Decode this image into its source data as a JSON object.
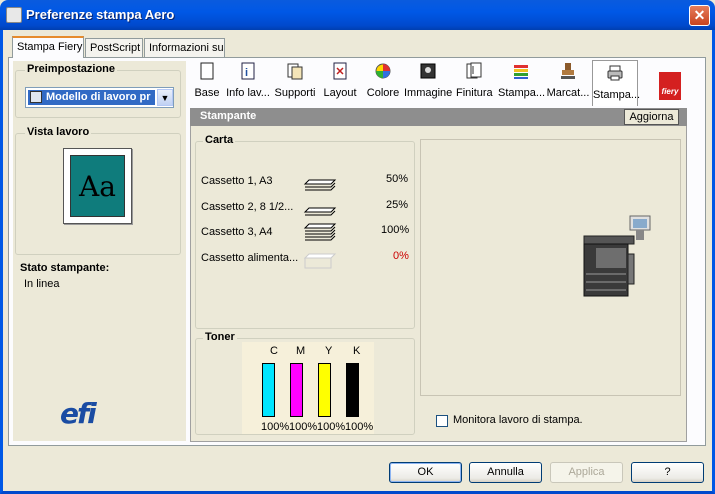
{
  "window": {
    "title": "Preferenze stampa Aero",
    "close_symbol": "✕"
  },
  "tabs": [
    {
      "label": "Stampa Fiery",
      "active": true
    },
    {
      "label": "PostScript",
      "active": false
    },
    {
      "label": "Informazioni su",
      "active": false
    }
  ],
  "left": {
    "preset_label": "Preimpostazione",
    "preset_value": "Modello di lavoro pr",
    "view_label": "Vista lavoro",
    "preview_text": "Aa",
    "printer_status_label": "Stato stampante:",
    "printer_status_value": "In linea",
    "brand_logo": "efi"
  },
  "toolbar": [
    {
      "label": "Base",
      "icon": "page-icon"
    },
    {
      "label": "Info lav...",
      "icon": "info-icon"
    },
    {
      "label": "Supporti",
      "icon": "media-icon"
    },
    {
      "label": "Layout",
      "icon": "layout-icon"
    },
    {
      "label": "Colore",
      "icon": "color-wheel-icon"
    },
    {
      "label": "Immagine",
      "icon": "image-icon"
    },
    {
      "label": "Finitura",
      "icon": "finishing-icon"
    },
    {
      "label": "Stampa...",
      "icon": "stack-icon"
    },
    {
      "label": "Marcat...",
      "icon": "stamp-icon"
    },
    {
      "label": "Stampa...",
      "icon": "printer-icon"
    }
  ],
  "fiery_logo_text": "fiery",
  "panel": {
    "title": "Stampante",
    "refresh_label": "Aggiorna",
    "paper_label": "Carta",
    "trays": [
      {
        "name": "Cassetto 1, A3",
        "level": "50%",
        "color": "#000000"
      },
      {
        "name": "Cassetto 2, 8 1/2...",
        "level": "25%",
        "color": "#000000"
      },
      {
        "name": "Cassetto 3, A4",
        "level": "100%",
        "color": "#000000"
      },
      {
        "name": "Cassetto alimenta...",
        "level": "0%",
        "color": "#CC0000"
      }
    ],
    "toner_label": "Toner",
    "toners": [
      {
        "name": "C",
        "level": "100%",
        "color": "#00E5FF"
      },
      {
        "name": "M",
        "level": "100%",
        "color": "#FF00FF"
      },
      {
        "name": "Y",
        "level": "100%",
        "color": "#FFFF00"
      },
      {
        "name": "K",
        "level": "100%",
        "color": "#000000"
      }
    ],
    "monitor_label": "Monitora lavoro di stampa."
  },
  "buttons": {
    "ok": "OK",
    "cancel": "Annulla",
    "apply": "Applica",
    "help": "?"
  }
}
